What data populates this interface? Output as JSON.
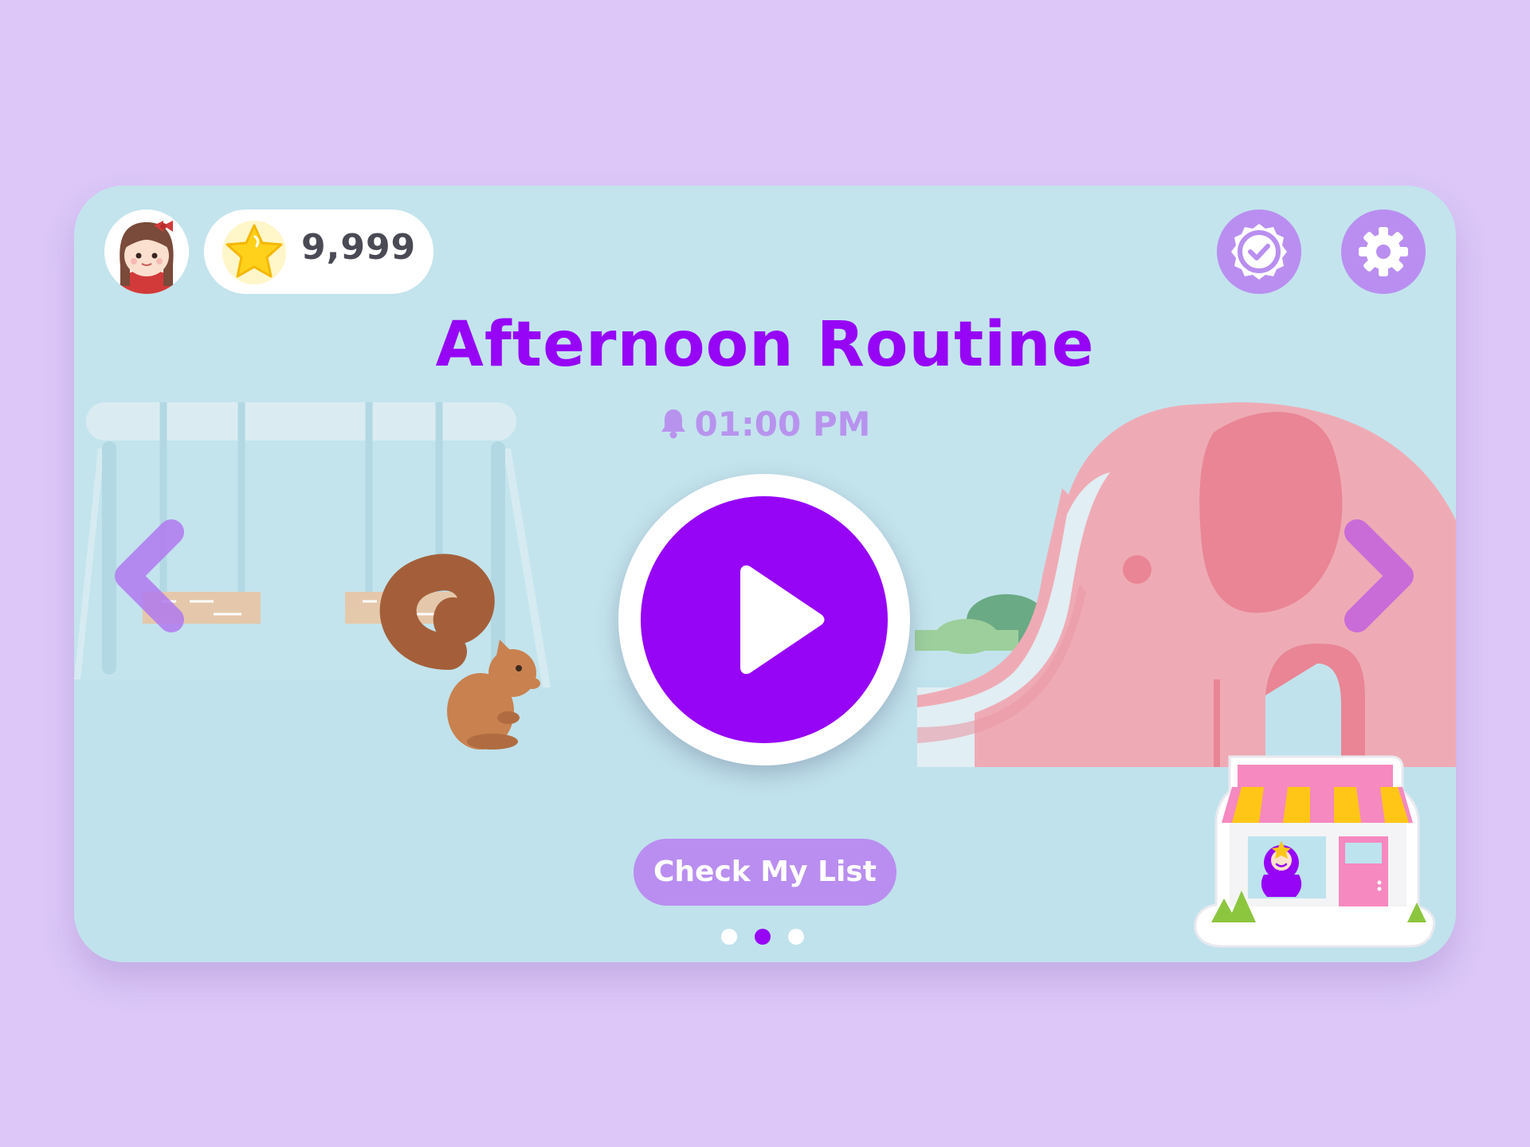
{
  "header": {
    "star_count": "9,999"
  },
  "routine": {
    "title": "Afternoon Routine",
    "time": "01:00 PM"
  },
  "actions": {
    "check_list_label": "Check My List"
  },
  "pagination": {
    "total_pages": 3,
    "active_page": 2
  },
  "icons": {
    "avatar": "girl-avatar",
    "star": "star-icon",
    "badge": "badge-check-icon",
    "settings": "gear-icon",
    "bell": "bell-icon",
    "play": "play-icon",
    "prev": "chevron-left-icon",
    "next": "chevron-right-icon",
    "shop": "shop-icon"
  },
  "colors": {
    "background": "#dcc7f8",
    "card": "#c3e4ed",
    "accent": "#9605f5",
    "soft_purple": "#b98ef0",
    "elephant": "#efabb5"
  }
}
